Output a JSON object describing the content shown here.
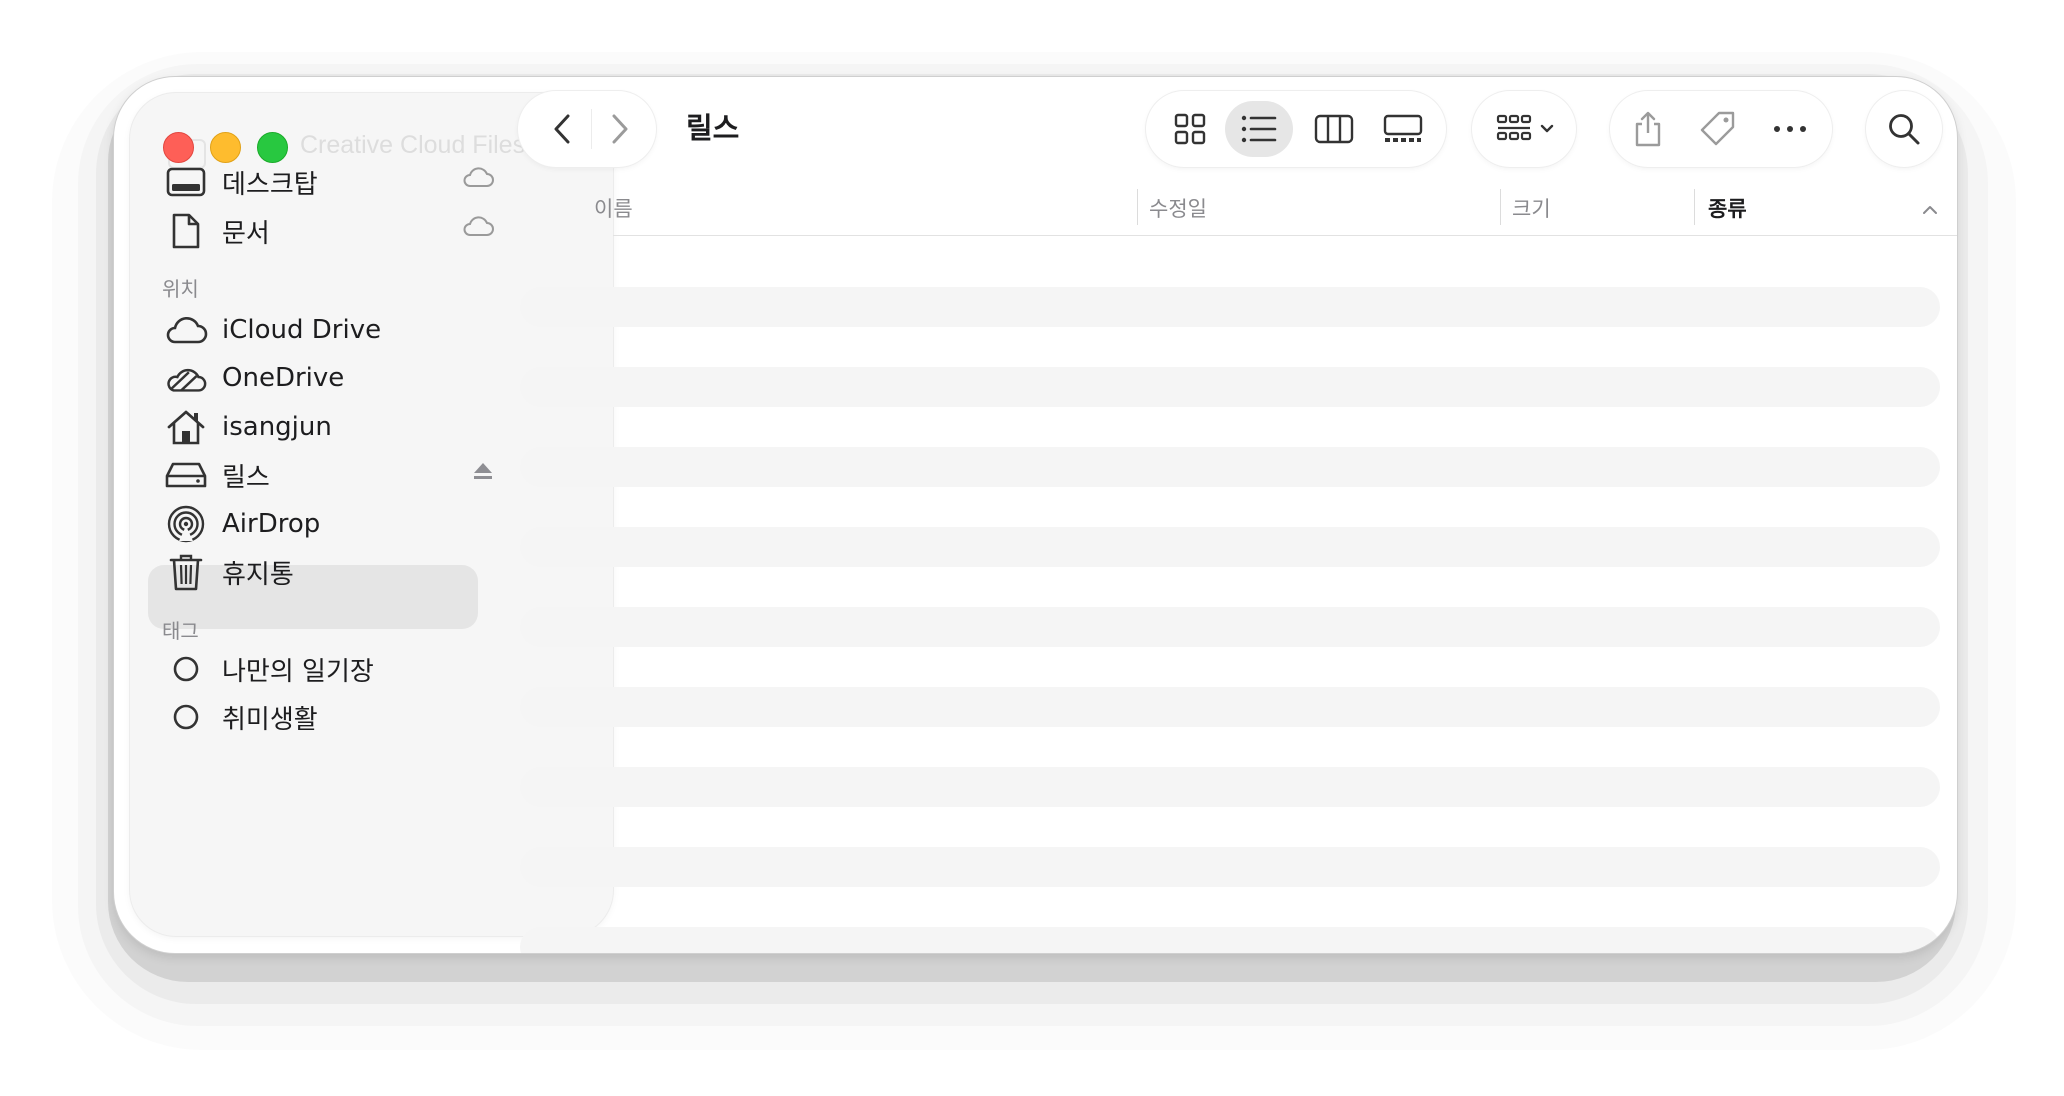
{
  "window": {
    "faded_title": "Creative Cloud Files",
    "path_title": "릴스"
  },
  "sidebar": {
    "favorites": [
      {
        "label": "데스크탑",
        "icon": "desktop-icon",
        "cloud": true
      },
      {
        "label": "문서",
        "icon": "document-icon",
        "cloud": true
      }
    ],
    "locations_header": "위치",
    "locations": [
      {
        "label": "iCloud Drive",
        "icon": "cloud-icon"
      },
      {
        "label": "OneDrive",
        "icon": "onedrive-icon"
      },
      {
        "label": "isangjun",
        "icon": "home-icon"
      },
      {
        "label": "릴스",
        "icon": "drive-icon",
        "selected": true,
        "eject": true
      },
      {
        "label": "AirDrop",
        "icon": "airdrop-icon"
      },
      {
        "label": "휴지통",
        "icon": "trash-icon"
      }
    ],
    "tags_header": "태그",
    "tags": [
      {
        "label": "나만의 일기장",
        "icon": "tag-circle-icon"
      },
      {
        "label": "취미생활",
        "icon": "tag-circle-icon"
      }
    ]
  },
  "columns": {
    "name": "이름",
    "modified": "수정일",
    "size": "크기",
    "kind": "종류"
  },
  "colors": {
    "close": "#fe5f57",
    "minimize": "#febc2e",
    "zoom": "#28c840"
  },
  "view": {
    "mode": "list"
  }
}
